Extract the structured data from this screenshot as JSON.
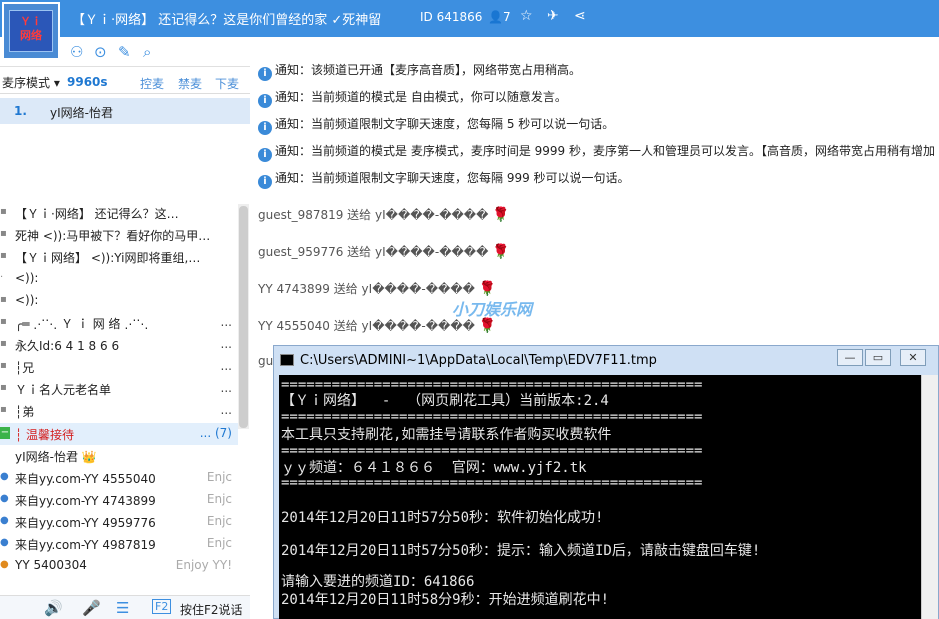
{
  "topbar": {
    "logo_text": "Ｙｉ\n网络",
    "title": "【Ｙｉ·网络】 还记得么？这是你们曾经的家 ✓死神留",
    "channel_id": "ID 641866",
    "members": "7"
  },
  "mode": {
    "label": "麦序模式",
    "timer": "9960s",
    "btn1": "控麦",
    "btn2": "禁麦",
    "btn3": "下麦"
  },
  "queue": {
    "index": "1.",
    "name": "yI网络-怡君"
  },
  "tree": [
    {
      "mk": "▪",
      "text": "【Ｙｉ·网络】 还记得么？这…",
      "right": ""
    },
    {
      "mk": "▪",
      "text": "死神 <)):马甲被下？看好你的马甲…",
      "right": ""
    },
    {
      "mk": "▪",
      "text": "【Ｙｉ网络】 <)):Yi网即将重组,…",
      "right": ""
    },
    {
      "mk": "·",
      "text": "<)):",
      "right": ""
    },
    {
      "mk": "▪",
      "text": "<)):",
      "right": ""
    },
    {
      "mk": "▪",
      "text": "╭═ ⋰⋱ Ｙ ｉ 网 络 ⋰⋱",
      "right": "..."
    },
    {
      "mk": "▪",
      "text": "      永久Id:6 4 1 8 6 6",
      "right": "..."
    },
    {
      "mk": "▪",
      "text": "┆兄",
      "right": "..."
    },
    {
      "mk": "▪",
      "text": "         Ｙｉ名人元老名单",
      "right": "..."
    },
    {
      "mk": "▪",
      "text": "┆弟",
      "right": "..."
    },
    {
      "mk": "−",
      "text": "┆          温馨接待",
      "right": "... (7)"
    },
    {
      "mk": "",
      "text": "   yI网络-怡君 👑",
      "right": ""
    },
    {
      "mk": "●",
      "text": "   来自yy.com-YY 4555040",
      "right": "Enjc"
    },
    {
      "mk": "●",
      "text": "   来自yy.com-YY 4743899",
      "right": "Enjc"
    },
    {
      "mk": "●",
      "text": "   来自yy.com-YY 4959776",
      "right": "Enjc"
    },
    {
      "mk": "●",
      "text": "   来自yy.com-YY 4987819",
      "right": "Enjc"
    },
    {
      "mk": "●",
      "text": "   YY 5400304",
      "right": "Enjoy YY!"
    }
  ],
  "notices": [
    {
      "text": "通知：该频道已开通【麦序高音质】，网络带宽占用稍高。"
    },
    {
      "text": "通知：当前频道的模式是 自由模式，你可以随意发言。"
    },
    {
      "text": "通知：当前频道限制文字聊天速度，您每隔 5 秒可以说一句话。"
    },
    {
      "text": "通知：当前频道的模式是 麦序模式，麦序时间是 9999 秒，麦序第一人和管理员可以发言。【高音质，网络带宽占用稍有增加"
    },
    {
      "text": "通知：当前频道限制文字聊天速度，您每隔 999 秒可以说一句话。"
    }
  ],
  "gifts": [
    {
      "text": "guest_987819 送给 yI����-����"
    },
    {
      "text": "guest_959776 送给 yI����-����"
    },
    {
      "text": "YY 4743899 送给 yI����-����"
    },
    {
      "text": "YY 4555040 送给 yI����-����"
    },
    {
      "text": "gu"
    }
  ],
  "watermark": "小刀娱乐网",
  "bottom": {
    "f2_label": "按住F2说话"
  },
  "cmd": {
    "title": "C:\\Users\\ADMINI~1\\AppData\\Local\\Temp\\EDV7F11.tmp",
    "lines": [
      "==================================================",
      "【Ｙｉ网络】  -  （网页刷花工具）当前版本:2.4",
      "==================================================",
      "本工具只支持刷花,如需挂号请联系作者购买收费软件",
      "==================================================",
      "ｙｙ频道：６４１８６６  官网：www.yjf2.tk",
      "==================================================",
      "",
      "2014年12月20日11时57分50秒：软件初始化成功!",
      "",
      "2014年12月20日11时57分50秒：提示：输入频道ID后，请敲击键盘回车键!",
      "",
      "请输入要进的频道ID：641866",
      "2014年12月20日11时58分9秒：开始进频道刷花中!"
    ]
  }
}
